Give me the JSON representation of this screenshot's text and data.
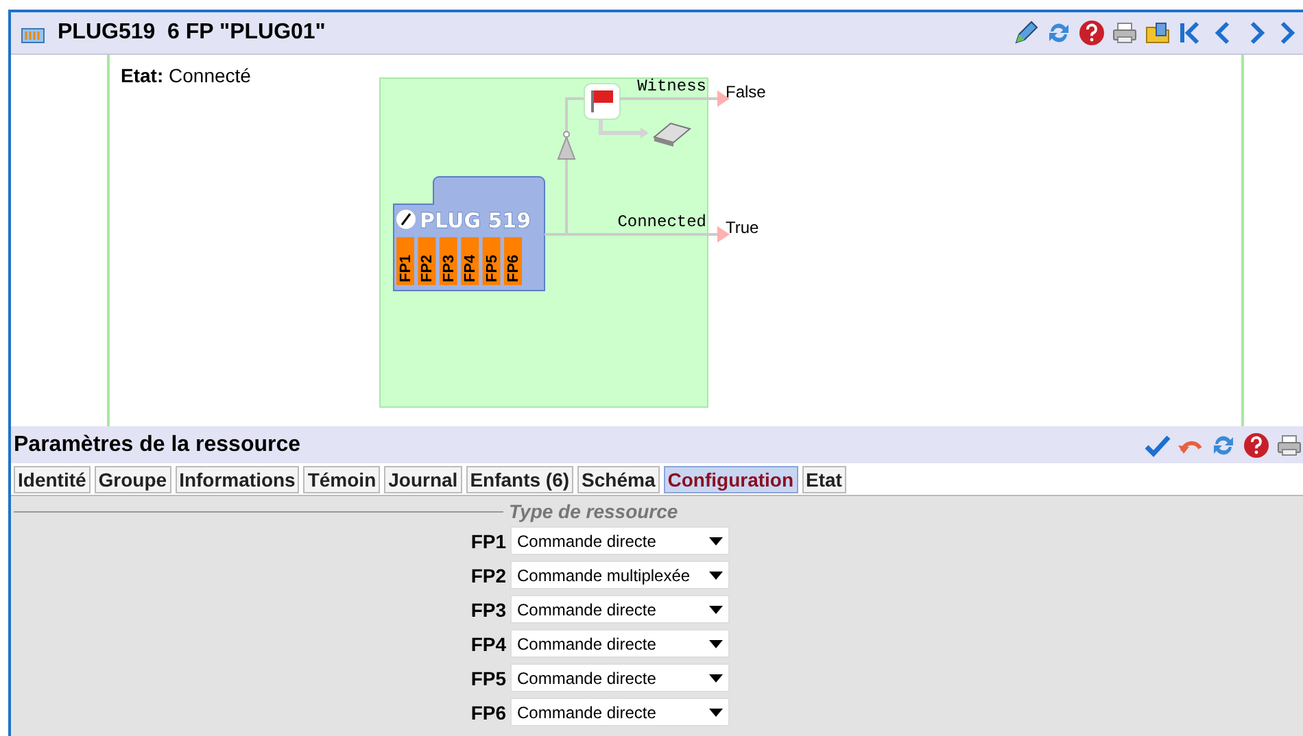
{
  "header": {
    "title": "PLUG519  6 FP \"PLUG01\""
  },
  "status": {
    "label": "Etat:",
    "value": "Connecté"
  },
  "diagram": {
    "node": {
      "title": "PLUG 519",
      "ports": [
        "FP1",
        "FP2",
        "FP3",
        "FP4",
        "FP5",
        "FP6"
      ]
    },
    "outputs": [
      {
        "label": "Witness",
        "value": "False"
      },
      {
        "label": "Connected",
        "value": "True"
      }
    ]
  },
  "panel": {
    "title": "Paramètres de la ressource",
    "tabs": [
      {
        "label": "Identité",
        "selected": false
      },
      {
        "label": "Groupe",
        "selected": false
      },
      {
        "label": "Informations",
        "selected": false
      },
      {
        "label": "Témoin",
        "selected": false
      },
      {
        "label": "Journal",
        "selected": false
      },
      {
        "label": "Enfants (6)",
        "selected": false
      },
      {
        "label": "Schéma",
        "selected": false
      },
      {
        "label": "Configuration",
        "selected": true
      },
      {
        "label": "Etat",
        "selected": false
      }
    ],
    "section": "Type de ressource",
    "fields": [
      {
        "label": "FP1",
        "value": "Commande directe"
      },
      {
        "label": "FP2",
        "value": "Commande multiplexée"
      },
      {
        "label": "FP3",
        "value": "Commande directe"
      },
      {
        "label": "FP4",
        "value": "Commande directe"
      },
      {
        "label": "FP5",
        "value": "Commande directe"
      },
      {
        "label": "FP6",
        "value": "Commande directe"
      }
    ]
  }
}
